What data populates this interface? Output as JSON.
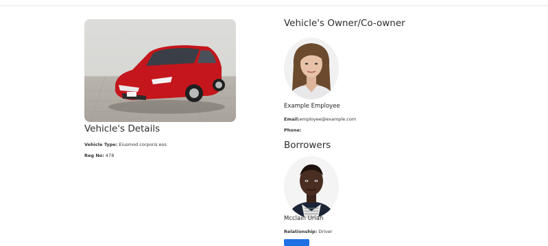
{
  "vehicle": {
    "details_title": "Vehicle's Details",
    "type_label": "Vehicle Type:",
    "type_value": "Eiusmod corporis eos",
    "reg_label": "Reg No:",
    "reg_value": "478"
  },
  "owner": {
    "section_title": "Vehicle's Owner/Co-owner",
    "name": "Example Employee",
    "email_label": "Email:",
    "email_value": "employee@example.com",
    "phone_label": "Phone:",
    "phone_value": ""
  },
  "borrowers": {
    "section_title": "Borrowers",
    "name": "Mcclain Uriah",
    "relationship_label": "Relationship:",
    "relationship_value": "Driver"
  },
  "colors": {
    "button": "#1f6fe5",
    "car": "#c4161c"
  }
}
